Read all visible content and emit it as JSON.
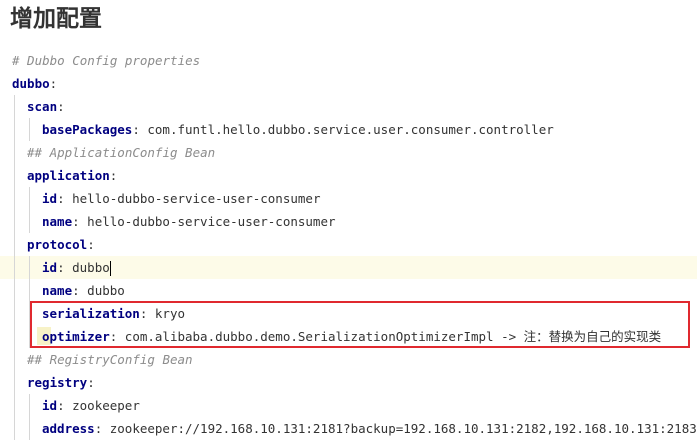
{
  "title": "增加配置",
  "lines": [
    {
      "indent": 0,
      "comment": "# Dubbo Config properties"
    },
    {
      "indent": 0,
      "key": "dubbo",
      "colon": ":"
    },
    {
      "indent": 1,
      "key": "scan",
      "colon": ":"
    },
    {
      "indent": 2,
      "key": "basePackages",
      "colon": ":",
      "value": " com.funtl.hello.dubbo.service.user.consumer.controller"
    },
    {
      "indent": 1,
      "comment": "## ApplicationConfig Bean"
    },
    {
      "indent": 1,
      "key": "application",
      "colon": ":"
    },
    {
      "indent": 2,
      "key": "id",
      "colon": ":",
      "value": " hello-dubbo-service-user-consumer"
    },
    {
      "indent": 2,
      "key": "name",
      "colon": ":",
      "value": " hello-dubbo-service-user-consumer"
    },
    {
      "indent": 1,
      "key": "protocol",
      "colon": ":"
    },
    {
      "indent": 2,
      "key": "id",
      "colon": ":",
      "value": " dubbo",
      "highlight": true,
      "cursor": true
    },
    {
      "indent": 2,
      "key": "name",
      "colon": ":",
      "value": " dubbo"
    },
    {
      "indent": 2,
      "key": "serialization",
      "colon": ":",
      "value": " kryo"
    },
    {
      "indent": 2,
      "key": "optimizer",
      "colon": ":",
      "value": " com.alibaba.dubbo.demo.SerializationOptimizerImpl -> 注：替换为自己的实现类",
      "mark": true
    },
    {
      "indent": 1,
      "comment": "## RegistryConfig Bean"
    },
    {
      "indent": 1,
      "key": "registry",
      "colon": ":"
    },
    {
      "indent": 2,
      "key": "id",
      "colon": ":",
      "value": " zookeeper"
    },
    {
      "indent": 2,
      "key": "address",
      "colon": ":",
      "value": " zookeeper://192.168.10.131:2181?backup=192.168.10.131:2182,192.168.10.131:2183"
    }
  ]
}
